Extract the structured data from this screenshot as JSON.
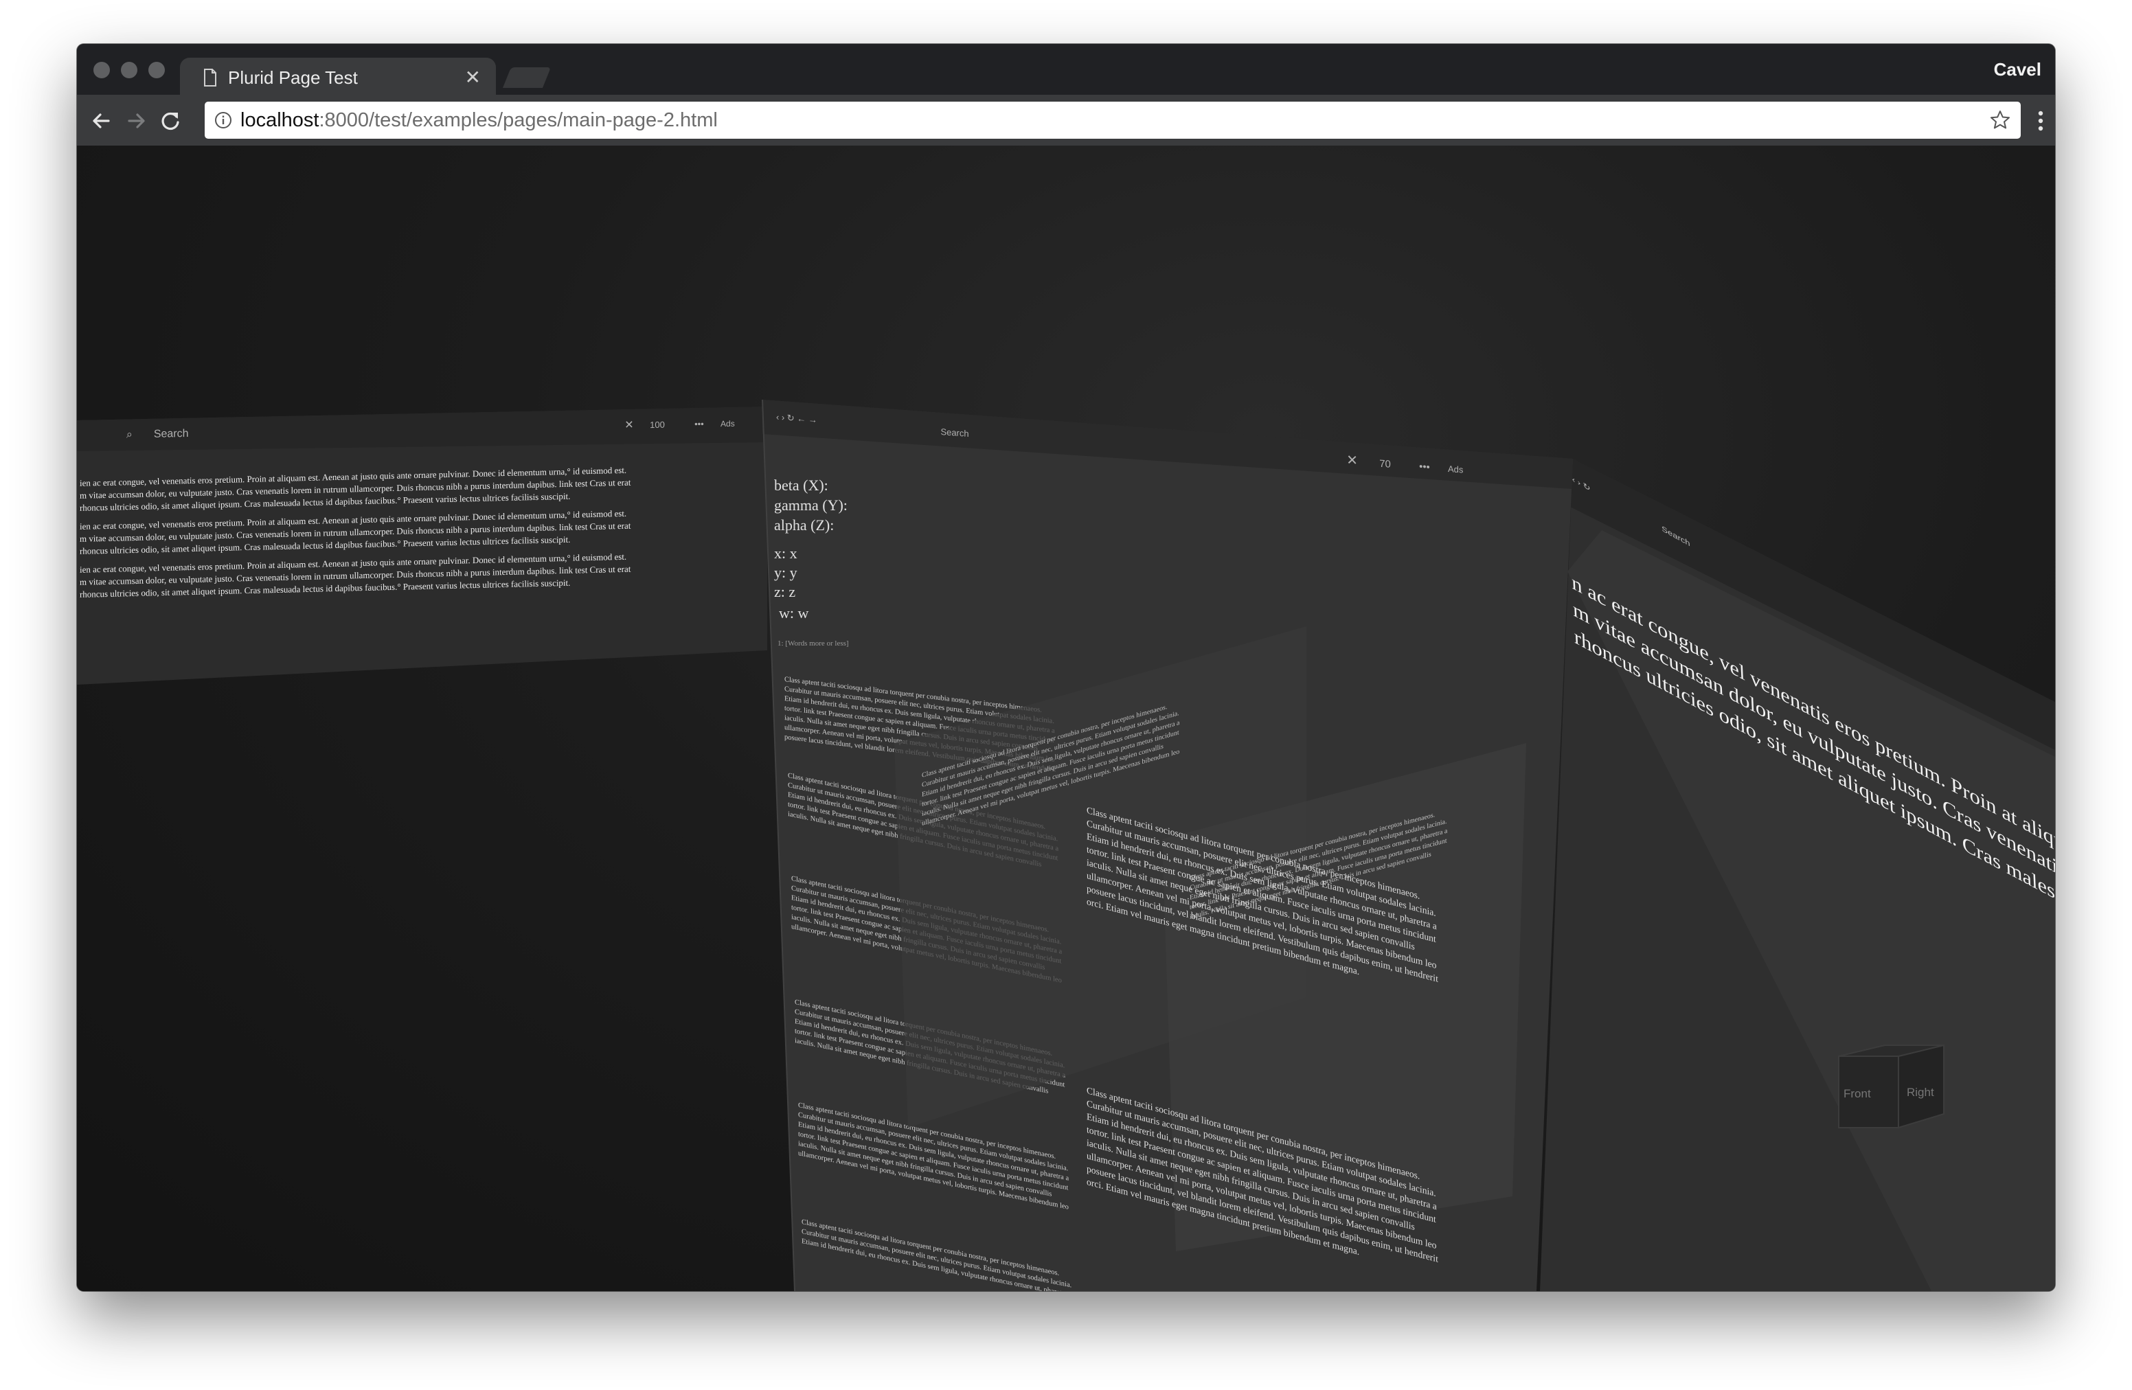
{
  "browser": {
    "tab": {
      "title": "Plurid Page Test"
    },
    "profile_name": "Cavel",
    "address": {
      "host": "localhost",
      "path": ":8000/test/examples/pages/main-page-2.html"
    }
  },
  "plurid": {
    "left_page": {
      "toolbar": {
        "search": "Search",
        "zoom": "100",
        "more": "•••",
        "ads": "Ads"
      },
      "paragraphs": [
        "ien ac erat congue, vel venenatis eros pretium. Proin at aliquam est. Aenean at justo quis ante ornare pulvinar. Donec id elementum urna,° id euismod est.",
        "m vitae accumsan dolor, eu vulputate justo. Cras venenatis lorem in rutrum ullamcorper. Duis rhoncus nibh a purus interdum dapibus. link test Cras ut erat",
        "rhoncus ultricies odio, sit amet aliquet ipsum. Cras malesuada lectus id dapibus faucibus.° Praesent varius lectus ultrices facilisis suscipit."
      ]
    },
    "center_page": {
      "toolbar": {
        "search": "Search",
        "zoom": "70",
        "more": "•••",
        "ads": "Ads"
      },
      "orientation": [
        {
          "label": "beta (X):"
        },
        {
          "label": "gamma (Y):"
        },
        {
          "label": "alpha (Z):"
        }
      ],
      "coordinates": [
        {
          "label": "x: x"
        },
        {
          "label": "y: y"
        },
        {
          "label": "z: z"
        },
        {
          "label": "w: w"
        }
      ],
      "link_note": "1: [Words more or less]",
      "lines": [
        "Class aptent taciti sociosqu ad litora torquent per conubia nostra, per inceptos himenaeos.",
        "Curabitur ut mauris accumsan, posuere elit nec, ultrices purus. Etiam volutpat sodales lacinia.",
        "Etiam id hendrerit dui, eu rhoncus ex. Duis sem ligula, vulputate rhoncus ornare ut, pharetra a",
        "tortor. link test Praesent congue ac sapien et aliquam. Fusce iaculis urna porta metus tincidunt",
        "iaculis. Nulla sit amet neque eget nibh fringilla cursus. Duis in arcu sed sapien convallis",
        "ullamcorper. Aenean vel mi porta, volutpat metus vel, lobortis turpis. Maecenas bibendum leo",
        "posuere lacus tincidunt, vel blandit lorem eleifend. Vestibulum quis dapibus enim, ut hendrerit",
        "orci. Etiam vel mauris eget magna tincidunt pretium bibendum et magna."
      ]
    },
    "right_page": {
      "toolbar": {
        "search": "Search"
      },
      "lines": [
        "n ac erat congue, vel venenatis eros pretium. Proin at aliquam est. Aenean at justo quis ante ornare",
        "m vitae accumsan dolor, eu vulputate justo. Cras venenatis lorem in rutrum ullamcorper. Duis rhonc",
        "rhoncus ultricies odio, sit amet aliquet ipsum. Cras malesuada lectus id dapibus faucibus. ■ Praesent"
      ]
    },
    "view_cube": {
      "front": "Front",
      "right": "Right"
    }
  }
}
